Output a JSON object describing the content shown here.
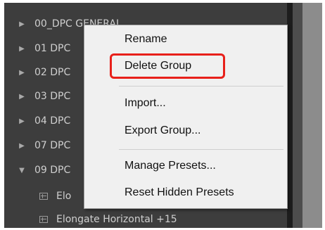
{
  "panel": {
    "items": [
      {
        "type": "group",
        "expanded": false,
        "label": "00_DPC GENERAL"
      },
      {
        "type": "group",
        "expanded": false,
        "label": "01 DPC"
      },
      {
        "type": "group",
        "expanded": false,
        "label": "02 DPC"
      },
      {
        "type": "group",
        "expanded": false,
        "label": "03 DPC"
      },
      {
        "type": "group",
        "expanded": false,
        "label": "04 DPC"
      },
      {
        "type": "group",
        "expanded": false,
        "label": "07 DPC"
      },
      {
        "type": "group",
        "expanded": true,
        "label": "09 DPC"
      },
      {
        "type": "preset",
        "label": "Elo"
      },
      {
        "type": "preset",
        "label": "Elongate Horizontal +15"
      }
    ]
  },
  "context_menu": {
    "items": [
      {
        "label": "Rename"
      },
      {
        "label": "Delete Group",
        "highlighted": true
      },
      {
        "label": "Import..."
      },
      {
        "label": "Export Group..."
      },
      {
        "label": "Manage Presets..."
      },
      {
        "label": "Reset Hidden Presets"
      }
    ]
  },
  "icons": {
    "collapsed": "▶",
    "expanded": "▼"
  },
  "colors": {
    "panel_bg": "#3d3d3d",
    "text": "#cfcfcf",
    "menu_bg": "#f0f0f0",
    "highlight": "#e8201a"
  }
}
